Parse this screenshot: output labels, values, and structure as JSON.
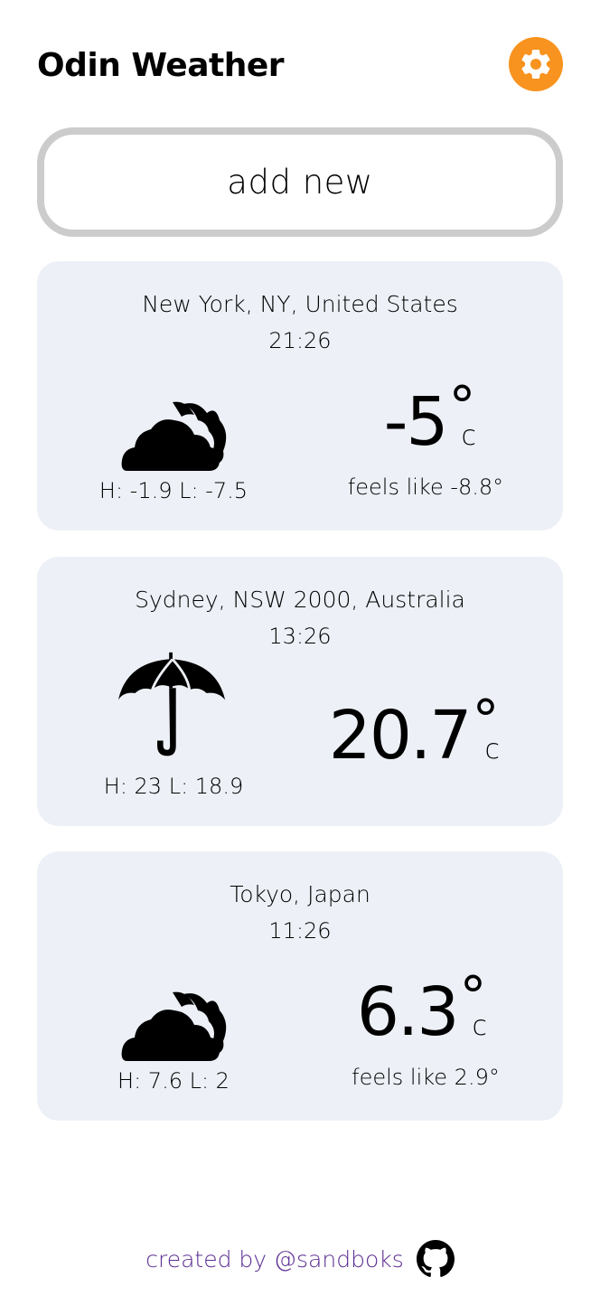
{
  "app": {
    "title": "Odin Weather"
  },
  "settings": {
    "icon": "gear-icon",
    "color": "#F7931E"
  },
  "add_new": {
    "label": "add new"
  },
  "cards": [
    {
      "location": "New York, NY, United States",
      "time": "21:26",
      "icon": "cloudy-icon",
      "hilo": "H: -1.9 L: -7.5",
      "temp": "-5",
      "degree": "°",
      "unit": "c",
      "feels_like": "feels like -8.8°"
    },
    {
      "location": "Sydney, NSW 2000, Australia",
      "time": "13:26",
      "icon": "umbrella-icon",
      "hilo": "H: 23 L: 18.9",
      "temp": "20.7",
      "degree": "°",
      "unit": "c"
    },
    {
      "location": "Tokyo, Japan",
      "time": "11:26",
      "icon": "cloudy-icon",
      "hilo": "H: 7.6 L: 2",
      "temp": "6.3",
      "degree": "°",
      "unit": "c",
      "feels_like": "feels like 2.9°"
    }
  ],
  "footer": {
    "text": "created by @sandboks",
    "icon": "github-icon",
    "color": "#5b2d91"
  },
  "colors": {
    "card_bg": "#edf1f7",
    "button_border": "#cccccc"
  }
}
